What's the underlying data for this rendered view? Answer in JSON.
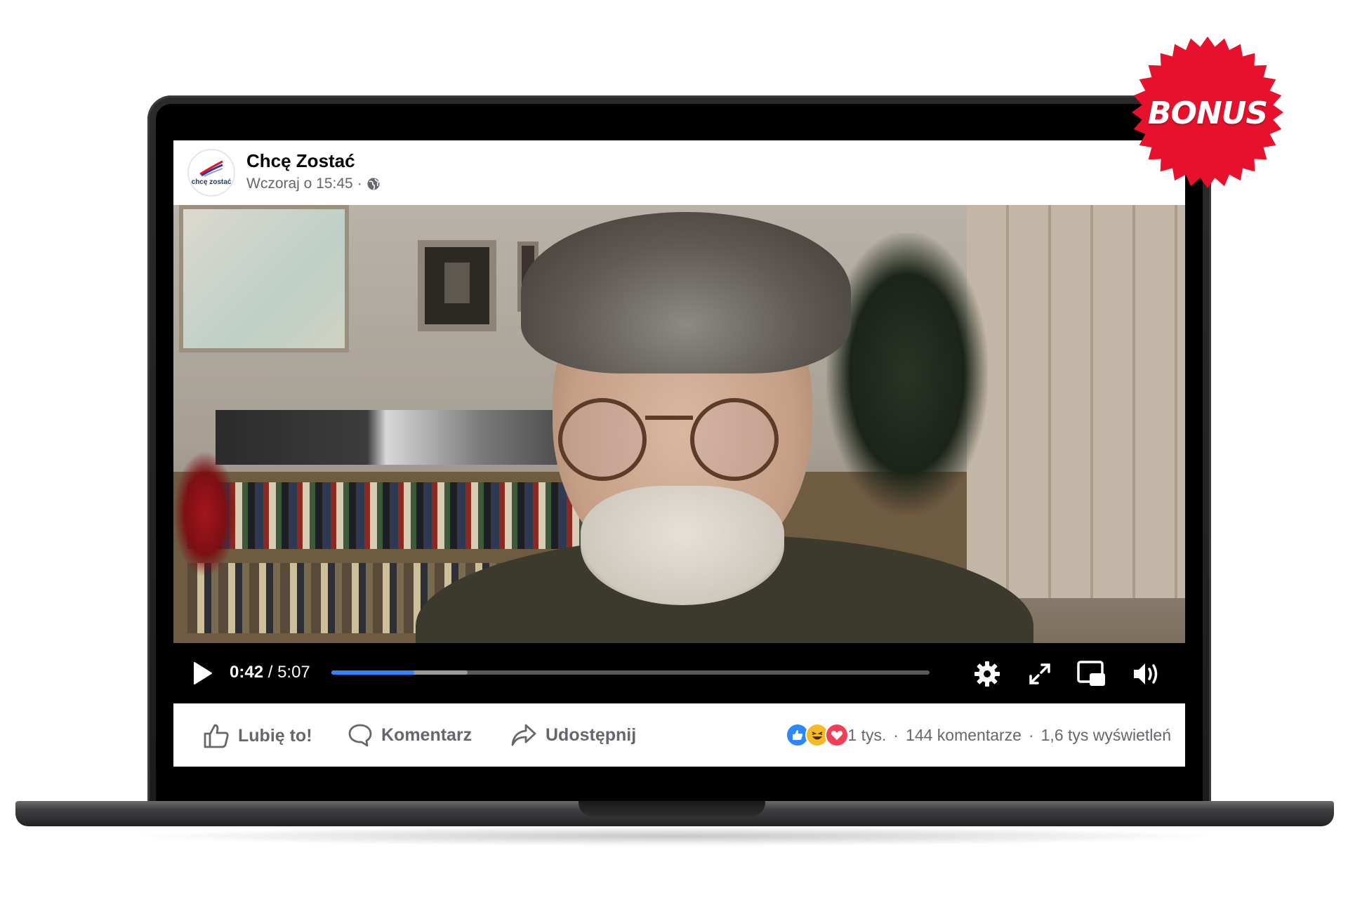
{
  "post": {
    "page_name": "Chcę Zostać",
    "timestamp": "Wczoraj o 15:45",
    "separator": "·",
    "avatar_text": "chcę zostać"
  },
  "player": {
    "current_time": "0:42",
    "duration_sep": " / ",
    "duration": "5:07",
    "played_fraction": 0.138,
    "buffered_fraction": 0.228
  },
  "actions": {
    "like": "Lubię to!",
    "comment": "Komentarz",
    "share": "Udostępnij"
  },
  "stats": {
    "reactions_count": "1 tys.",
    "sep": "·",
    "comments": "144 komentarze",
    "views": "1,6 tys wyświetleń"
  },
  "badge": {
    "label": "BONUS"
  },
  "colors": {
    "fb_blue": "#2d88ff",
    "badge_red": "#e8112d",
    "text_secondary": "#65676b"
  },
  "icons": [
    "globe-icon",
    "play-icon",
    "settings-gear-icon",
    "fullscreen-icon",
    "picture-in-picture-icon",
    "volume-icon",
    "like-thumb-icon",
    "comment-bubble-icon",
    "share-arrow-icon",
    "like-reaction-icon",
    "haha-reaction-icon",
    "love-reaction-icon"
  ]
}
